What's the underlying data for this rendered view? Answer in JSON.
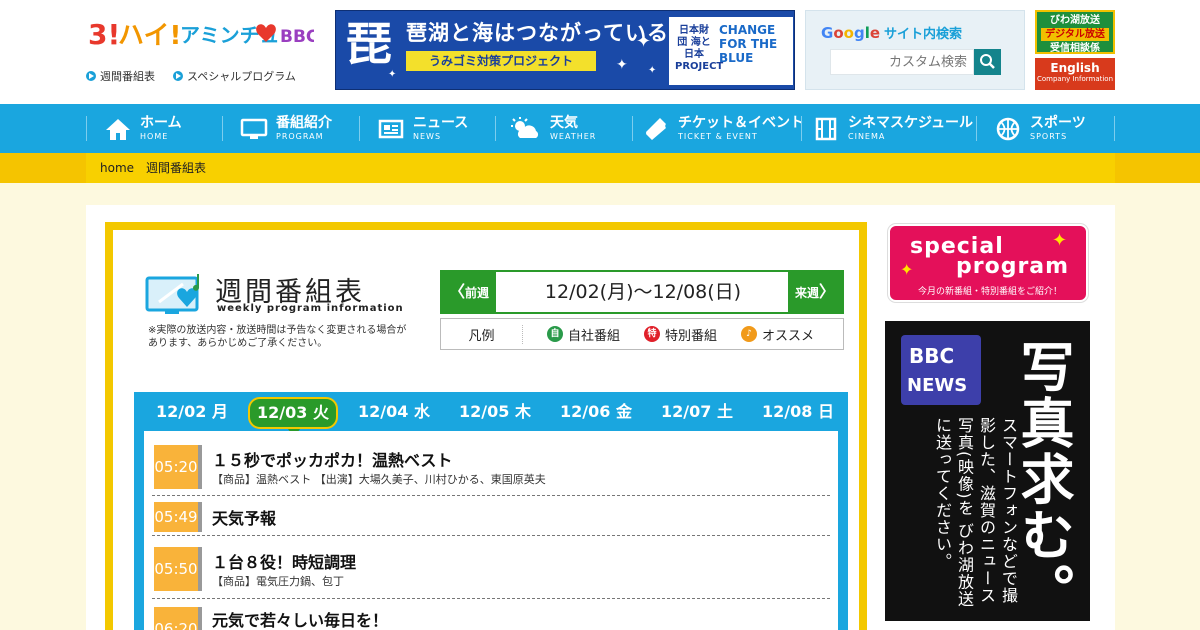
{
  "header": {
    "logo_text": "3!ハイ!アミンチュ BBC",
    "sublinks": [
      "週間番組表",
      "スペシャルプログラム"
    ],
    "banner": {
      "big_char": "琵",
      "title": "琶湖と海はつながっている!",
      "subtitle": "うみゴミ対策プロジェクト",
      "partner_left": "日本財団 海と日本 PROJECT",
      "partner_right": "CHANGE FOR THE BLUE"
    },
    "search": {
      "label": "サイト内検索",
      "placeholder": "カスタム検索"
    },
    "biwa_button": {
      "line1": "びわ湖放送",
      "line2": "デジタル放送",
      "line3": "受信相談係"
    },
    "english_button": {
      "line1": "English",
      "line2": "Company Information"
    }
  },
  "nav": [
    {
      "label": "ホーム",
      "sub": "HOME",
      "icon": "home-icon"
    },
    {
      "label": "番組紹介",
      "sub": "PROGRAM",
      "icon": "tv-icon"
    },
    {
      "label": "ニュース",
      "sub": "NEWS",
      "icon": "newspaper-icon"
    },
    {
      "label": "天気",
      "sub": "WEATHER",
      "icon": "weather-icon"
    },
    {
      "label": "チケット＆イベント",
      "sub": "TICKET & EVENT",
      "icon": "ticket-icon"
    },
    {
      "label": "シネマスケジュール",
      "sub": "CINEMA",
      "icon": "film-icon"
    },
    {
      "label": "スポーツ",
      "sub": "SPORTS",
      "icon": "ball-icon"
    }
  ],
  "breadcrumb": [
    "home",
    "週間番組表"
  ],
  "page": {
    "title": "週間番組表",
    "subtitle": "weekly program information",
    "notice": "※実際の放送内容・放送時間は予告なく変更される場合があります、あらかじめご了承ください。"
  },
  "date_nav": {
    "prev": "前週",
    "range": "12/02(月)～12/08(日)",
    "next": "来週"
  },
  "legend": {
    "head": "凡例",
    "items": [
      {
        "mark": "自",
        "label": "自社番組",
        "color": "#2a9a4a"
      },
      {
        "mark": "特",
        "label": "特別番組",
        "color": "#e0202a"
      },
      {
        "mark": "♪",
        "label": "オススメ",
        "color": "#f19a1a"
      }
    ]
  },
  "days": [
    "12/02 月",
    "12/03 火",
    "12/04 水",
    "12/05 木",
    "12/06 金",
    "12/07 土",
    "12/08 日"
  ],
  "active_day": 1,
  "programs": [
    {
      "time": "05:20",
      "title": "１５秒でポッカポカ！温熱ベスト",
      "desc": "【商品】温熱ベスト 【出演】大場久美子、川村ひかる、東国原英夫"
    },
    {
      "time": "05:49",
      "title": "天気予報",
      "desc": ""
    },
    {
      "time": "05:50",
      "title": "１台８役！時短調理",
      "desc": "【商品】電気圧力鍋、包丁"
    },
    {
      "time": "06:20",
      "title": "元気で若々しい毎日を！",
      "desc": ""
    }
  ],
  "sidebar": {
    "special_line1": "special",
    "special_line2": "program",
    "special_caption": "今月の新番組・特別番組をご紹介！",
    "news_logo": "BBC NEWS",
    "news_catch": "写真求む。",
    "news_text": "スマートフォンなどで撮影した、滋賀のニュース写真(映像)を びわ湖放送に送ってください。"
  },
  "colors": {
    "nav_blue": "#1aa6df",
    "accent_yellow": "#f3c800",
    "active_green": "#2a9a2a",
    "time_orange": "#f9b33a"
  }
}
